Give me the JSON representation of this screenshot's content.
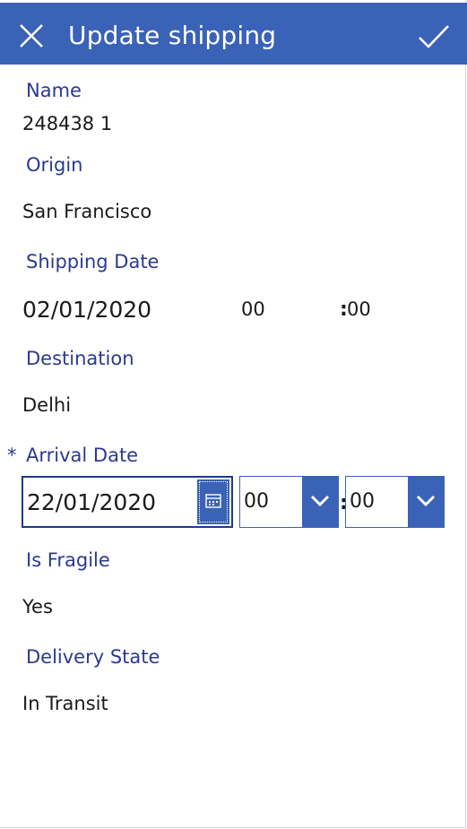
{
  "header": {
    "title": "Update shipping"
  },
  "fields": {
    "name": {
      "label": "Name",
      "value": "248438 1"
    },
    "origin": {
      "label": "Origin",
      "value": "San Francisco"
    },
    "shipping_date": {
      "label": "Shipping Date",
      "date": "02/01/2020",
      "hour": "00",
      "colon": ":",
      "minute": "00"
    },
    "destination": {
      "label": "Destination",
      "value": "Delhi"
    },
    "arrival_date": {
      "required_marker": "*",
      "label": "Arrival Date",
      "date": "22/01/2020",
      "hour": "00",
      "colon": ":",
      "minute": "00"
    },
    "is_fragile": {
      "label": "Is Fragile",
      "value": "Yes"
    },
    "delivery_state": {
      "label": "Delivery State",
      "value": "In Transit"
    }
  },
  "colors": {
    "accent": "#3a62b7",
    "label": "#2b3a8f",
    "focus_border": "#1e3a8a"
  },
  "icons": {
    "close": "close-icon",
    "confirm": "checkmark-icon",
    "calendar": "calendar-icon",
    "dropdown": "chevron-down-icon"
  }
}
